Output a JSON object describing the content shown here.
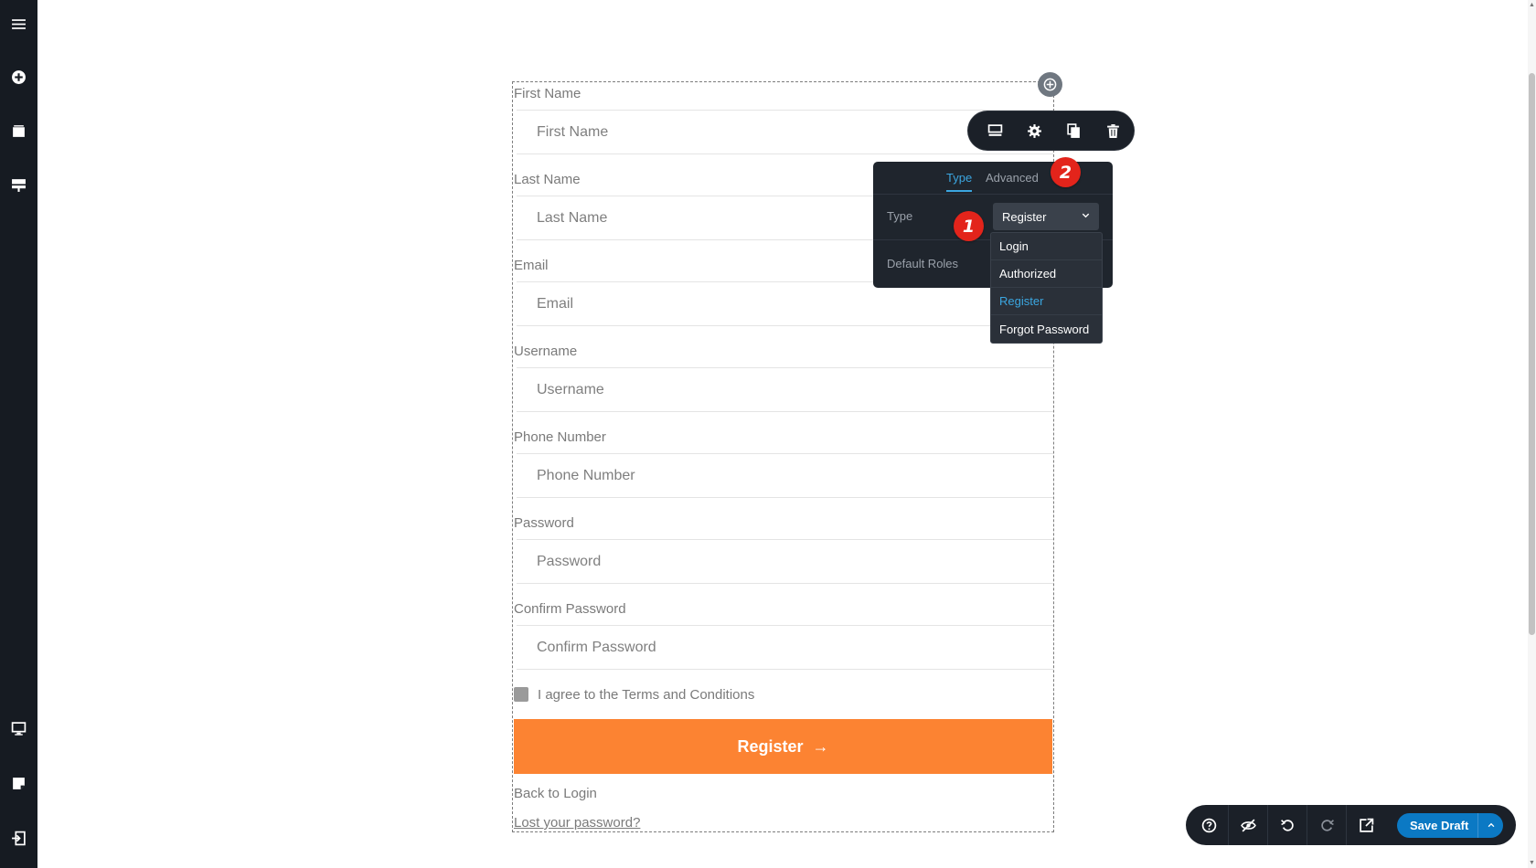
{
  "sidebar": {
    "icons": [
      "menu-icon",
      "add-circle-icon",
      "layers-icon",
      "components-icon",
      "desktop-icon",
      "page-icon",
      "exit-icon"
    ]
  },
  "form": {
    "fields": [
      {
        "label": "First Name",
        "placeholder": "First Name"
      },
      {
        "label": "Last Name",
        "placeholder": "Last Name"
      },
      {
        "label": "Email",
        "placeholder": "Email"
      },
      {
        "label": "Username",
        "placeholder": "Username"
      },
      {
        "label": "Phone Number",
        "placeholder": "Phone Number"
      },
      {
        "label": "Password",
        "placeholder": "Password"
      },
      {
        "label": "Confirm Password",
        "placeholder": "Confirm Password"
      }
    ],
    "terms_label": "I agree to the Terms and Conditions",
    "submit_label": "Register",
    "submit_arrow": "→",
    "back_link": "Back to Login",
    "lost_link": "Lost your password?"
  },
  "toolbar": {
    "icons": [
      "layout-icon",
      "gear-icon",
      "copy-icon",
      "trash-icon"
    ]
  },
  "panel": {
    "tabs": [
      "Type",
      "Advanced"
    ],
    "type_label": "Type",
    "type_value": "Register",
    "roles_label": "Default Roles",
    "options": [
      {
        "label": "Login",
        "active": false
      },
      {
        "label": "Authorized",
        "active": false
      },
      {
        "label": "Register",
        "active": true
      },
      {
        "label": "Forgot Password",
        "active": false
      }
    ]
  },
  "badges": [
    "1",
    "2"
  ],
  "bottom_bar": {
    "icons": [
      "help-icon",
      "visibility-off-icon",
      "undo-icon",
      "redo-icon",
      "external-link-icon"
    ],
    "save_label": "Save Draft"
  },
  "colors": {
    "accent": "#fc8332",
    "primary": "#0b79c4",
    "dark": "#1b2028",
    "badge": "#e3241b"
  }
}
